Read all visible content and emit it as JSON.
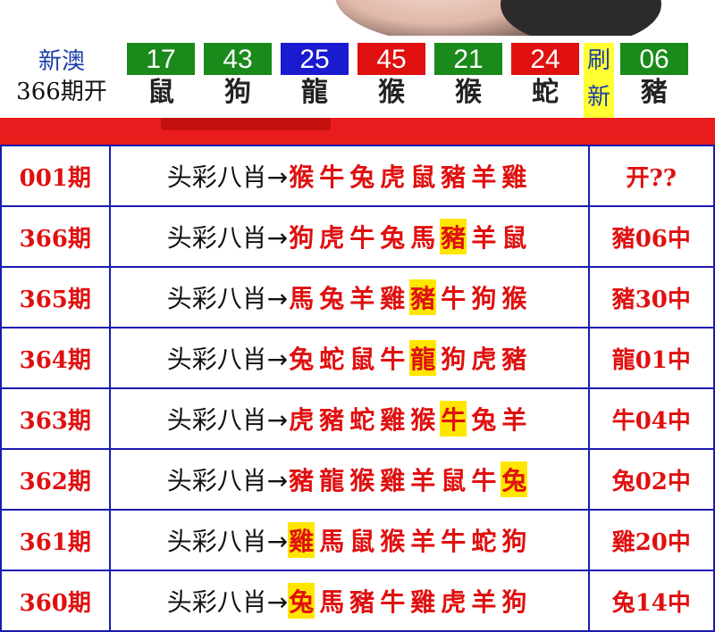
{
  "header": {
    "brand": "新澳",
    "period": "366期开",
    "balls": [
      {
        "number": "17",
        "zodiac": "鼠",
        "color": "#1a8a1a"
      },
      {
        "number": "43",
        "zodiac": "狗",
        "color": "#1a8a1a"
      },
      {
        "number": "25",
        "zodiac": "龍",
        "color": "#1a1ad0"
      },
      {
        "number": "45",
        "zodiac": "猴",
        "color": "#e01010"
      },
      {
        "number": "21",
        "zodiac": "猴",
        "color": "#1a8a1a"
      },
      {
        "number": "24",
        "zodiac": "蛇",
        "color": "#e01010"
      },
      {
        "number": "06",
        "zodiac": "豬",
        "color": "#1a8a1a"
      }
    ],
    "refresh_top": "刷",
    "refresh_bottom": "新"
  },
  "rows": [
    {
      "period": "001期",
      "label": "头彩八肖",
      "arrow": "→",
      "zodiacs": [
        "猴",
        "牛",
        "兔",
        "虎",
        "鼠",
        "豬",
        "羊",
        "雞"
      ],
      "hit": -1,
      "result": "开??"
    },
    {
      "period": "366期",
      "label": "头彩八肖",
      "arrow": "→",
      "zodiacs": [
        "狗",
        "虎",
        "牛",
        "兔",
        "馬",
        "豬",
        "羊",
        "鼠"
      ],
      "hit": 5,
      "result": "豬06中"
    },
    {
      "period": "365期",
      "label": "头彩八肖",
      "arrow": "→",
      "zodiacs": [
        "馬",
        "兔",
        "羊",
        "雞",
        "豬",
        "牛",
        "狗",
        "猴"
      ],
      "hit": 4,
      "result": "豬30中"
    },
    {
      "period": "364期",
      "label": "头彩八肖",
      "arrow": "→",
      "zodiacs": [
        "兔",
        "蛇",
        "鼠",
        "牛",
        "龍",
        "狗",
        "虎",
        "豬"
      ],
      "hit": 4,
      "result": "龍01中"
    },
    {
      "period": "363期",
      "label": "头彩八肖",
      "arrow": "→",
      "zodiacs": [
        "虎",
        "豬",
        "蛇",
        "雞",
        "猴",
        "牛",
        "兔",
        "羊"
      ],
      "hit": 5,
      "result": "牛04中"
    },
    {
      "period": "362期",
      "label": "头彩八肖",
      "arrow": "→",
      "zodiacs": [
        "豬",
        "龍",
        "猴",
        "雞",
        "羊",
        "鼠",
        "牛",
        "兔"
      ],
      "hit": 7,
      "result": "兔02中"
    },
    {
      "period": "361期",
      "label": "头彩八肖",
      "arrow": "→",
      "zodiacs": [
        "雞",
        "馬",
        "鼠",
        "猴",
        "羊",
        "牛",
        "蛇",
        "狗"
      ],
      "hit": 0,
      "result": "雞20中"
    },
    {
      "period": "360期",
      "label": "头彩八肖",
      "arrow": "→",
      "zodiacs": [
        "兔",
        "馬",
        "豬",
        "牛",
        "雞",
        "虎",
        "羊",
        "狗"
      ],
      "hit": 0,
      "result": "兔14中"
    }
  ]
}
